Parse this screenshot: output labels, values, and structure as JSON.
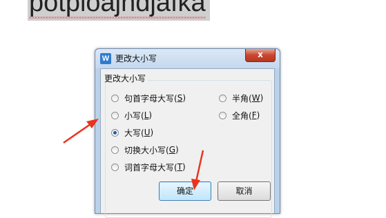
{
  "document": {
    "selected_text": "potploajndjafka"
  },
  "dialog": {
    "title": "更改大小写",
    "app_icon_letter": "W",
    "close_symbol": "x",
    "group_label": "更改大小写",
    "options_left": [
      {
        "text": "句首字母大写(",
        "key": "S",
        "end": ")",
        "checked": false
      },
      {
        "text": "小写(",
        "key": "L",
        "end": ")",
        "checked": false
      },
      {
        "text": "大写(",
        "key": "U",
        "end": ")",
        "checked": true
      },
      {
        "text": "切换大小写(",
        "key": "G",
        "end": ")",
        "checked": false
      },
      {
        "text": "词首字母大写(",
        "key": "T",
        "end": ")",
        "checked": false
      }
    ],
    "options_right": [
      {
        "text": "半角(",
        "key": "W",
        "end": ")",
        "checked": false
      },
      {
        "text": "全角(",
        "key": "F",
        "end": ")",
        "checked": false
      }
    ],
    "ok_label": "确定",
    "cancel_label": "取消"
  },
  "colors": {
    "annotation_arrow": "#e8341c",
    "accent": "#2e7bd1"
  }
}
